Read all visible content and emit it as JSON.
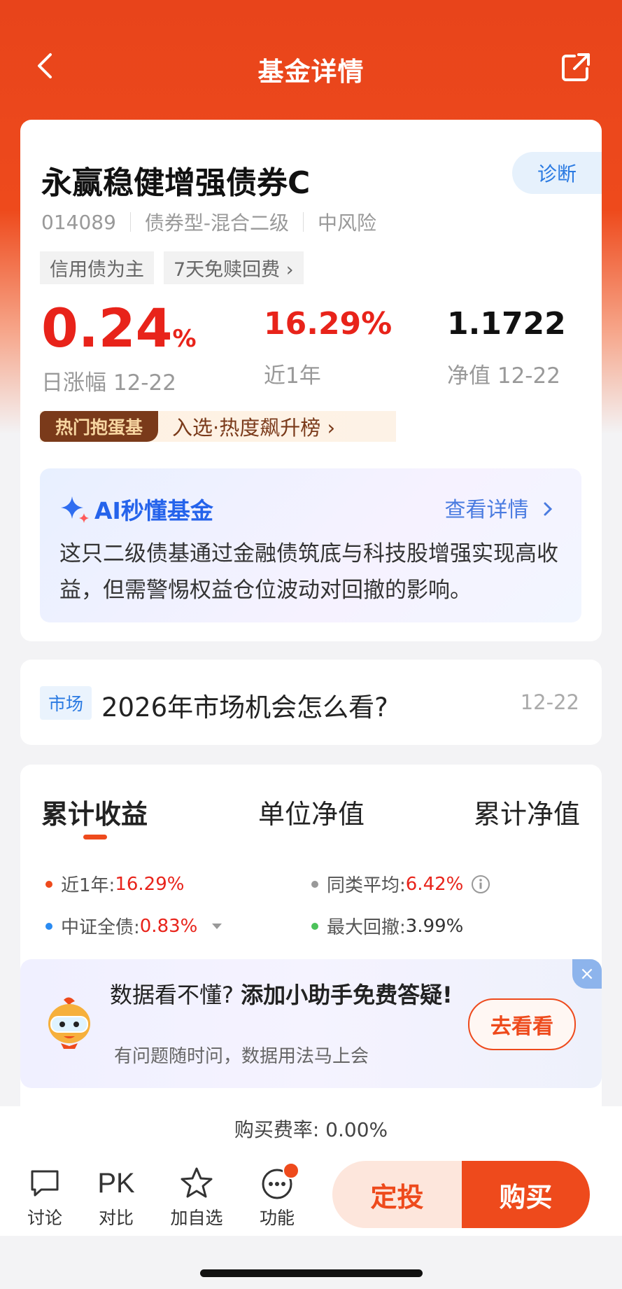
{
  "nav": {
    "title": "基金详情"
  },
  "fund": {
    "name": "永赢稳健增强债券C",
    "diagnose_label": "诊断",
    "code": "014089",
    "type": "债券型-混合二级",
    "risk": "中风险",
    "tags": [
      "信用债为主",
      "7天免赎回费 ›"
    ],
    "daily_change": "0.24",
    "daily_change_unit": "%",
    "daily_change_label": "日涨幅 12-22",
    "one_year": "16.29%",
    "one_year_label": "近1年",
    "nav_value": "1.1722",
    "nav_label": "净值 12-22",
    "hot_badge": "热门抱蛋基",
    "hot_text": "入选·热度飙升榜 ›"
  },
  "ai": {
    "title": "AI秒懂基金",
    "link": "查看详情",
    "text": "这只二级债基通过金融债筑底与科技股增强实现高收益，但需警惕权益仓位波动对回撤的影响。"
  },
  "news": {
    "tag": "市场",
    "title": "2026年市场机会怎么看?",
    "date": "12-22"
  },
  "chart_tabs": [
    "累计收益",
    "单位净值",
    "累计净值"
  ],
  "legend": [
    {
      "label": "近1年:",
      "value": "16.29%",
      "color": "#ee4a1c"
    },
    {
      "label": "同类平均:",
      "value": "6.42%",
      "color": "#999999"
    },
    {
      "label": "中证全债:",
      "value": "0.83%",
      "color": "#2a8bf2"
    },
    {
      "label": "最大回撤:",
      "value": "3.99%",
      "color": "#4cc25a"
    }
  ],
  "promo": {
    "line_a": "数据看不懂?",
    "line_b": "添加小助手免费答疑!",
    "sub": "有问题随时问，数据用法马上会",
    "cta": "去看看",
    "close": "×"
  },
  "fee": "购买费率: 0.00%",
  "toolbar": {
    "discuss": "讨论",
    "pk_glyph": "PK",
    "compare": "对比",
    "watch": "加自选",
    "more": "功能",
    "dingtou": "定投",
    "buy": "购买"
  }
}
